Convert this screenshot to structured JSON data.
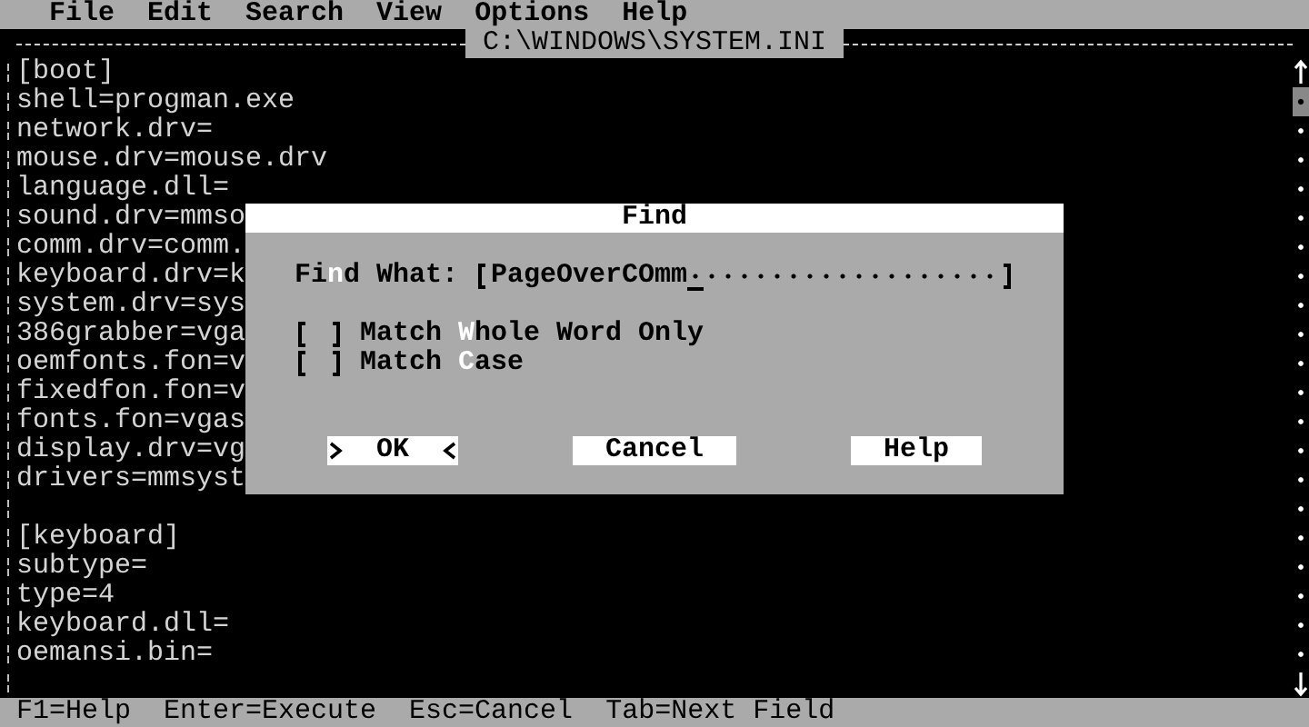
{
  "menu_bar": [
    "File",
    "Edit",
    "Search",
    "View",
    "Options",
    "Help"
  ],
  "editor": {
    "title": "C:\\WINDOWS\\SYSTEM.INI",
    "blocks": [
      {
        "lines": [
          "[boot]",
          "shell=progman.exe",
          "network.drv=",
          "mouse.drv=mouse.drv",
          "language.dll=",
          "sound.drv=mmso",
          "comm.drv=comm.",
          "keyboard.drv=k",
          "system.drv=sys",
          "386grabber=vga",
          "oemfonts.fon=v",
          "fixedfon.fon=v",
          "fonts.fon=vgas",
          "display.drv=vg",
          "drivers=mmsyst"
        ]
      },
      {
        "lines": [
          "[keyboard]",
          "subtype=",
          "type=4",
          "keyboard.dll=",
          "oemansi.bin="
        ]
      }
    ]
  },
  "dialog": {
    "title": "Find",
    "find_label": "Fi**n**d What:",
    "find_value": "PageOverCOmm",
    "options": [
      {
        "label": "Match **W**hole Word Only",
        "checked": false
      },
      {
        "label": "Match **C**ase",
        "checked": false
      }
    ],
    "buttons": [
      {
        "label": "OK",
        "selected": true
      },
      {
        "label": "Cancel",
        "selected": false
      },
      {
        "label": "Help",
        "selected": false
      }
    ]
  },
  "status_bar": [
    "F1=Help",
    "Enter=Execute",
    "Esc=Cancel",
    "Tab=Next Field"
  ]
}
